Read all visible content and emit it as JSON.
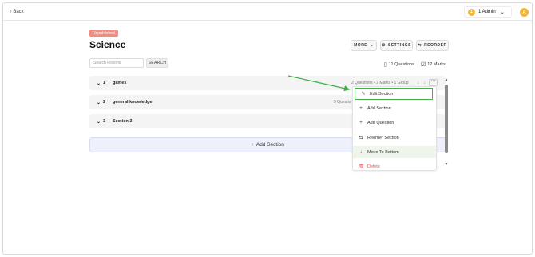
{
  "topbar": {
    "back_label": "Back",
    "admin_label": "1 Admin",
    "admin_coin": "1",
    "avatar_initial": "A"
  },
  "course": {
    "status_badge": "Unpublished",
    "title": "Science"
  },
  "toolbar": {
    "more_label": "MORE",
    "settings_label": "SETTINGS",
    "reorder_label": "REORDER"
  },
  "search": {
    "placeholder": "Search lessons",
    "button_label": "SEARCH"
  },
  "stats": {
    "questions": "11 Questions",
    "marks": "12 Marks"
  },
  "sections": [
    {
      "number": "1",
      "name": "games",
      "meta": "2 Questions • 2 Marks • 1 Group"
    },
    {
      "number": "2",
      "name": "general knowledge",
      "meta": "9 Questio"
    },
    {
      "number": "3",
      "name": "Section 3",
      "meta": ""
    }
  ],
  "add_section_label": "Add Section",
  "context_menu": {
    "items": [
      {
        "label": "Edit Section",
        "icon": "pencil-icon"
      },
      {
        "label": "Add Section",
        "icon": "plus-icon"
      },
      {
        "label": "Add Question",
        "icon": "plus-icon"
      },
      {
        "label": "Reorder Section",
        "icon": "reorder-icon"
      },
      {
        "label": "Move To Bottom",
        "icon": "arrow-down-icon"
      },
      {
        "label": "Delete",
        "icon": "trash-icon"
      }
    ]
  },
  "colors": {
    "badge": "#f28b82",
    "accent_coin": "#f3b43a",
    "annotation_arrow": "#3cb043",
    "delete": "#e05252"
  }
}
